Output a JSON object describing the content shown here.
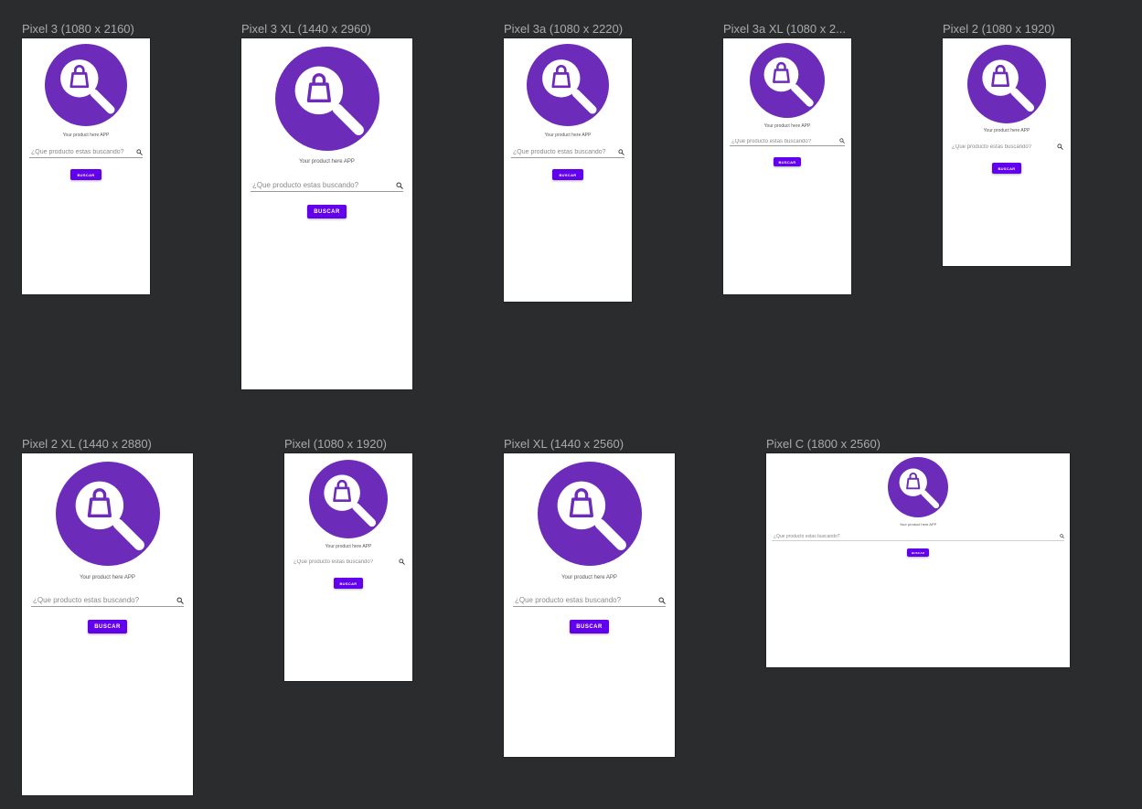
{
  "theme": {
    "canvas_bg": "#2b2c2e",
    "screen_bg": "#ffffff",
    "logo_circle": "#6c2bb8",
    "icon_white": "#ffffff",
    "button_bg": "#6200ee",
    "button_text": "#ffffff",
    "label_color": "#a9aaac"
  },
  "icons": {
    "logo": "shopping-bag-magnifier-icon",
    "search": "search-icon"
  },
  "devices": [
    {
      "label": "Pixel 3 (1080 x 2160)",
      "app_title": "Your product here APP",
      "search_placeholder": "¿Que producto estas buscando?",
      "button_label": "BUSCAR"
    },
    {
      "label": "Pixel 3 XL (1440 x 2960)",
      "app_title": "Your product here APP",
      "search_placeholder": "¿Que producto estas buscando?",
      "button_label": "BUSCAR"
    },
    {
      "label": "Pixel 3a (1080 x 2220)",
      "app_title": "Your product here APP",
      "search_placeholder": "¿Que producto estas buscando?",
      "button_label": "BUSCAR"
    },
    {
      "label": "Pixel 3a XL (1080 x 2...",
      "app_title": "Your product here APP",
      "search_placeholder": "¿Que producto estas buscando?",
      "button_label": "BUSCAR"
    },
    {
      "label": "Pixel 2 (1080 x 1920)",
      "app_title": "Your product here APP",
      "search_placeholder": "¿Que producto estas buscando?",
      "button_label": "BUSCAR"
    },
    {
      "label": "Pixel 2 XL (1440 x 2880)",
      "app_title": "Your product here APP",
      "search_placeholder": "¿Que producto estas buscando?",
      "button_label": "BUSCAR"
    },
    {
      "label": "Pixel (1080 x 1920)",
      "app_title": "Your product here APP",
      "search_placeholder": "¿Que producto estas buscando?",
      "button_label": "BUSCAR"
    },
    {
      "label": "Pixel XL (1440 x 2560)",
      "app_title": "Your product here APP",
      "search_placeholder": "¿Que producto estas buscando?",
      "button_label": "BUSCAR"
    },
    {
      "label": "Pixel C (1800 x 2560)",
      "app_title": "Your product here APP",
      "search_placeholder": "¿Que producto estas buscando?",
      "button_label": "BUSCAR"
    }
  ]
}
